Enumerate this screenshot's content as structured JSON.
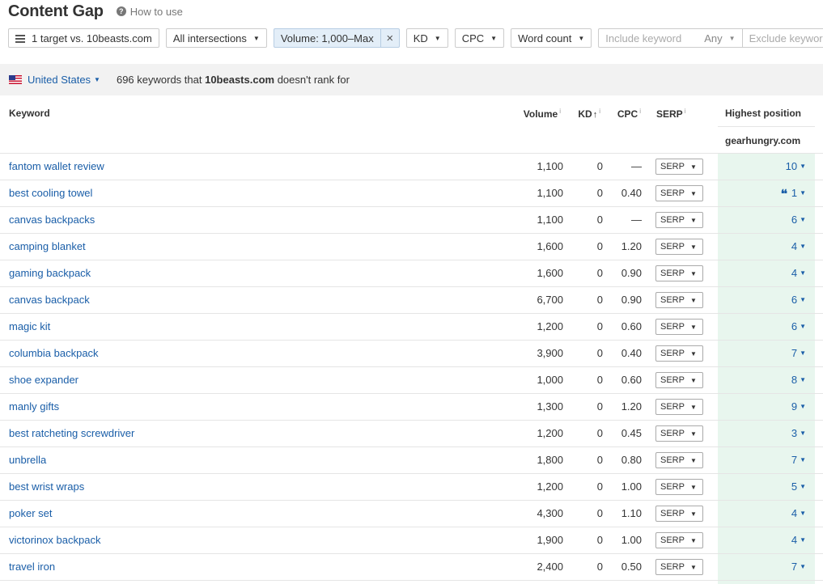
{
  "header": {
    "title": "Content Gap",
    "how_to_use": "How to use"
  },
  "filters": {
    "targets": "1 target vs. 10beasts.com",
    "intersections": "All intersections",
    "volume": "Volume: 1,000–Max",
    "kd": "KD",
    "cpc": "CPC",
    "word_count": "Word count",
    "include_placeholder": "Include keyword",
    "any": "Any",
    "exclude_placeholder": "Exclude keyword"
  },
  "info": {
    "country": "United States",
    "count_pre": "696 keywords that ",
    "domain": "10beasts.com",
    "count_post": " doesn't rank for"
  },
  "columns": {
    "keyword": "Keyword",
    "volume": "Volume",
    "kd": "KD",
    "kd_sort": "↑",
    "cpc": "CPC",
    "serp": "SERP",
    "info_mark": "i",
    "highest_position": "Highest position",
    "competitor": "gearhungry.com"
  },
  "rows": [
    {
      "keyword": "fantom wallet review",
      "volume": "1,100",
      "kd": "0",
      "cpc": "—",
      "serp": "SERP",
      "position": "10"
    },
    {
      "keyword": "best cooling towel",
      "volume": "1,100",
      "kd": "0",
      "cpc": "0.40",
      "serp": "SERP",
      "position": "1",
      "featured": true
    },
    {
      "keyword": "canvas backpacks",
      "volume": "1,100",
      "kd": "0",
      "cpc": "—",
      "serp": "SERP",
      "position": "6"
    },
    {
      "keyword": "camping blanket",
      "volume": "1,600",
      "kd": "0",
      "cpc": "1.20",
      "serp": "SERP",
      "position": "4"
    },
    {
      "keyword": "gaming backpack",
      "volume": "1,600",
      "kd": "0",
      "cpc": "0.90",
      "serp": "SERP",
      "position": "4"
    },
    {
      "keyword": "canvas backpack",
      "volume": "6,700",
      "kd": "0",
      "cpc": "0.90",
      "serp": "SERP",
      "position": "6"
    },
    {
      "keyword": "magic kit",
      "volume": "1,200",
      "kd": "0",
      "cpc": "0.60",
      "serp": "SERP",
      "position": "6"
    },
    {
      "keyword": "columbia backpack",
      "volume": "3,900",
      "kd": "0",
      "cpc": "0.40",
      "serp": "SERP",
      "position": "7"
    },
    {
      "keyword": "shoe expander",
      "volume": "1,000",
      "kd": "0",
      "cpc": "0.60",
      "serp": "SERP",
      "position": "8"
    },
    {
      "keyword": "manly gifts",
      "volume": "1,300",
      "kd": "0",
      "cpc": "1.20",
      "serp": "SERP",
      "position": "9"
    },
    {
      "keyword": "best ratcheting screwdriver",
      "volume": "1,200",
      "kd": "0",
      "cpc": "0.45",
      "serp": "SERP",
      "position": "3"
    },
    {
      "keyword": "unbrella",
      "volume": "1,800",
      "kd": "0",
      "cpc": "0.80",
      "serp": "SERP",
      "position": "7"
    },
    {
      "keyword": "best wrist wraps",
      "volume": "1,200",
      "kd": "0",
      "cpc": "1.00",
      "serp": "SERP",
      "position": "5"
    },
    {
      "keyword": "poker set",
      "volume": "4,300",
      "kd": "0",
      "cpc": "1.10",
      "serp": "SERP",
      "position": "4"
    },
    {
      "keyword": "victorinox backpack",
      "volume": "1,900",
      "kd": "0",
      "cpc": "1.00",
      "serp": "SERP",
      "position": "4"
    },
    {
      "keyword": "travel iron",
      "volume": "2,400",
      "kd": "0",
      "cpc": "0.50",
      "serp": "SERP",
      "position": "7"
    }
  ]
}
